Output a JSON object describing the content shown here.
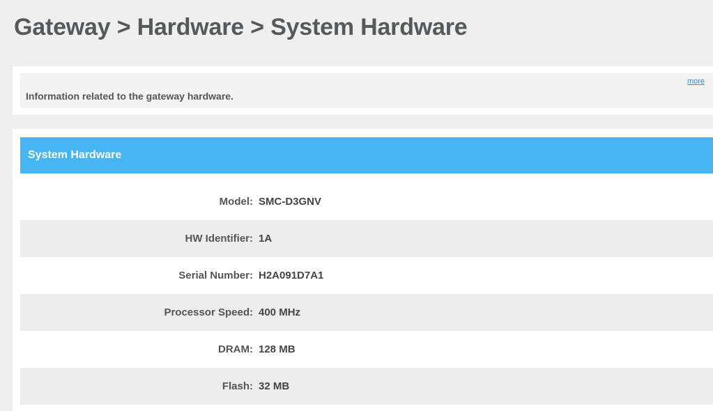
{
  "breadcrumb": {
    "title": "Gateway > Hardware > System Hardware"
  },
  "info": {
    "text": "Information related to the gateway hardware.",
    "more_label": "more"
  },
  "panel": {
    "title": "System Hardware"
  },
  "rows": [
    {
      "label": "Model",
      "value": "SMC-D3GNV"
    },
    {
      "label": "HW Identifier",
      "value": "1A"
    },
    {
      "label": "Serial Number",
      "value": "H2A091D7A1"
    },
    {
      "label": "Processor Speed",
      "value": "400 MHz"
    },
    {
      "label": "DRAM",
      "value": "128 MB"
    },
    {
      "label": "Flash",
      "value": "32 MB"
    }
  ],
  "colors": {
    "header_bg": "#efefef",
    "panel_header": "#45b6f2",
    "alt_row": "#ededed",
    "link": "#3b8fd6"
  }
}
